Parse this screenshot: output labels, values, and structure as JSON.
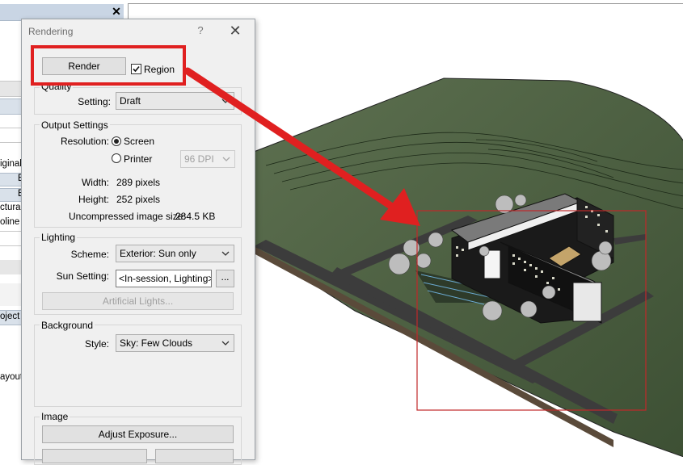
{
  "left_panel": {
    "fragments": [
      "iginal",
      "E",
      "E",
      "ctural",
      "oline",
      "oject",
      "ayout"
    ]
  },
  "dialog": {
    "title": "Rendering",
    "help_icon": "?",
    "close_icon": "✕",
    "render_button": "Render",
    "region_label": "Region",
    "region_checked": true,
    "quality": {
      "group_label": "Quality",
      "setting_label": "Setting:",
      "setting_value": "Draft"
    },
    "output": {
      "group_label": "Output Settings",
      "resolution_label": "Resolution:",
      "screen_label": "Screen",
      "printer_label": "Printer",
      "dpi_value": "96 DPI",
      "width_label": "Width:",
      "width_value": "289 pixels",
      "height_label": "Height:",
      "height_value": "252 pixels",
      "size_label": "Uncompressed image size:",
      "size_value": "284.5 KB"
    },
    "lighting": {
      "group_label": "Lighting",
      "scheme_label": "Scheme:",
      "scheme_value": "Exterior: Sun only",
      "sun_label": "Sun Setting:",
      "sun_value": "<In-session, Lighting>",
      "sun_browse": "...",
      "artificial_button": "Artificial Lights..."
    },
    "background": {
      "group_label": "Background",
      "style_label": "Style:",
      "style_value": "Sky: Few Clouds"
    },
    "image": {
      "group_label": "Image",
      "adjust_button": "Adjust Exposure..."
    }
  },
  "colors": {
    "annotation_red": "#e02020",
    "region_outline": "#c0282a",
    "terrain": "#4a5e3f",
    "road": "#3f3f3f"
  },
  "icons": [
    "close-icon",
    "help-icon",
    "chevron-down-icon",
    "checkmark-icon",
    "arrow-annotation"
  ]
}
